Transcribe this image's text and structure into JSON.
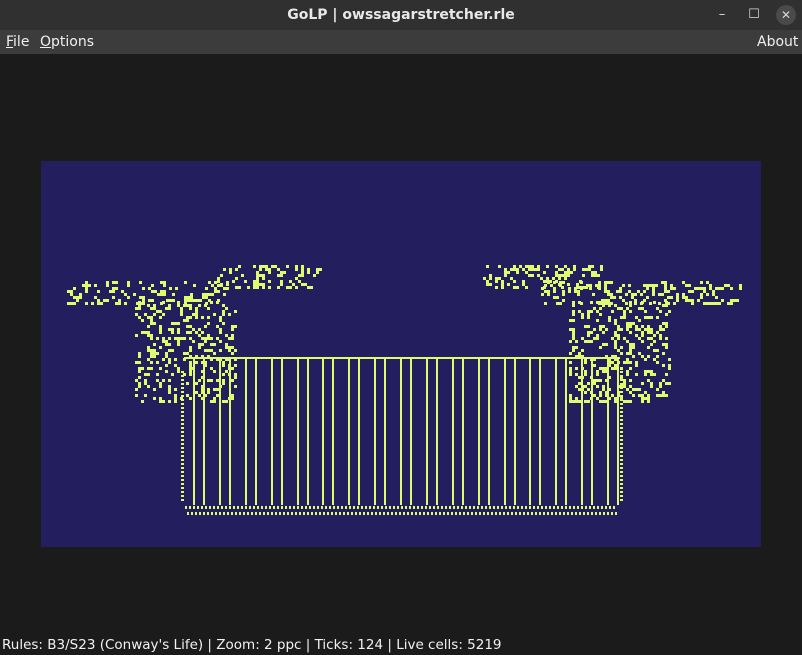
{
  "window": {
    "title": "GoLP | owssagarstretcher.rle",
    "minimize_glyph": "–",
    "maximize_glyph": "☐",
    "close_glyph": "✕"
  },
  "menu": {
    "file_label_first": "F",
    "file_label_rest": "ile",
    "options_label_first": "O",
    "options_label_rest": "ptions",
    "about_label": "About"
  },
  "board": {
    "background": "#231e5e",
    "cell_color": "#e2fb6e"
  },
  "status": {
    "text": "Rules: B3/S23 (Conway's Life) | Zoom: 2 ppc | Ticks: 124 | Live cells: 5219"
  }
}
